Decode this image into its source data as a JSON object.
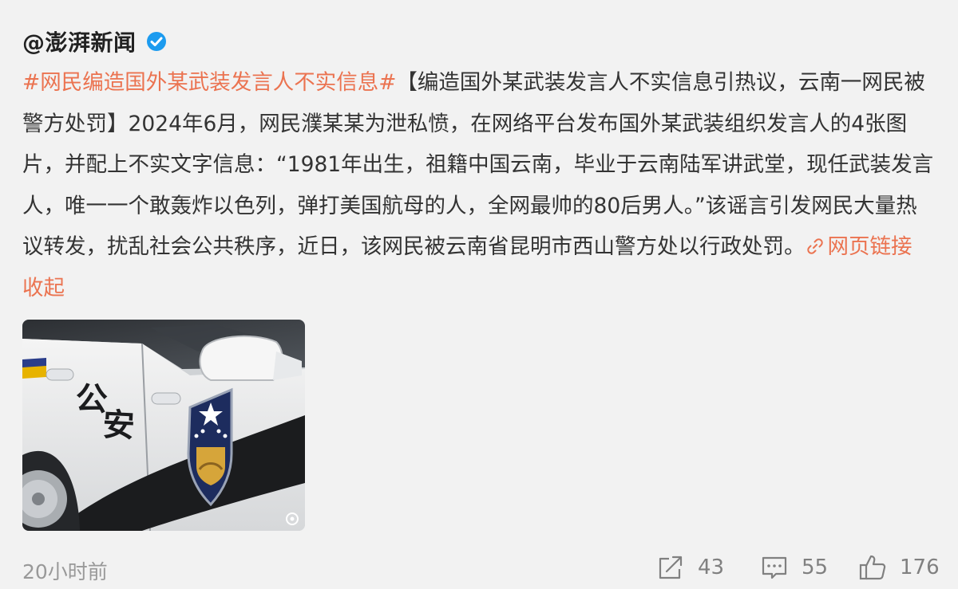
{
  "post": {
    "author": "@澎湃新闻",
    "verified": true,
    "topic": "#网民编造国外某武装发言人不实信息#",
    "text": "【编造国外某武装发言人不实信息引热议，云南一网民被警方处罚】2024年6月，网民濮某某为泄私愤，在网络平台发布国外某武装组织发言人的4张图片，并配上不实文字信息：“1981年出生，祖籍中国云南，毕业于云南陆军讲武堂，现任武装发言人，唯一一个敢轰炸以色列，弹打美国航母的人，全网最帅的80后男人。”该谣言引发网民大量热议转发，扰乱社会公共秩序，近日，该网民被云南省昆明市西山警方处以行政处罚。",
    "link_label": "网页链接",
    "collapse_label": "收起",
    "image": {
      "description_icon": "police-car-photo",
      "door_text": "公安"
    }
  },
  "footer": {
    "time": "20小时前",
    "repost_count": "43",
    "comment_count": "55",
    "like_count": "176"
  },
  "colors": {
    "accent": "#eb7350",
    "verified": "#1c9bef",
    "text": "#333333",
    "muted": "#999999",
    "background": "#f2f2f2"
  }
}
